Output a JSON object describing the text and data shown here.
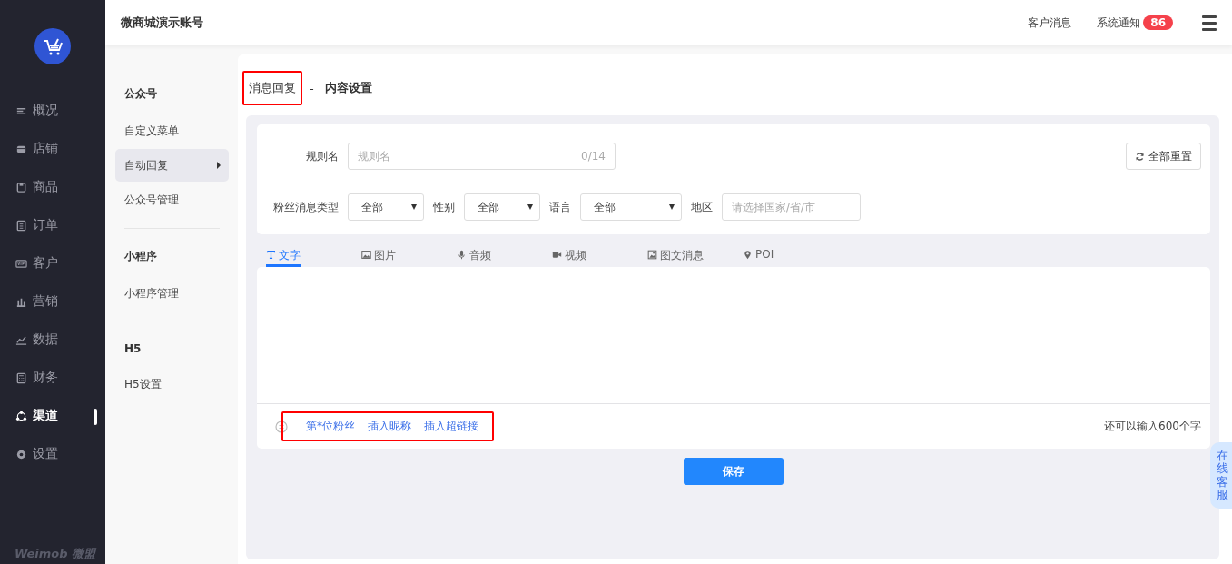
{
  "sidebar": {
    "logo": "Weimob 微盟",
    "items": [
      {
        "label": "概况",
        "kind": "lines",
        "selected": false
      },
      {
        "label": "店铺",
        "kind": "store",
        "selected": false
      },
      {
        "label": "商品",
        "kind": "bag",
        "selected": false
      },
      {
        "label": "订单",
        "kind": "list",
        "selected": false
      },
      {
        "label": "客户",
        "kind": "vip",
        "selected": false
      },
      {
        "label": "营销",
        "kind": "bars",
        "selected": false
      },
      {
        "label": "数据",
        "kind": "chart",
        "selected": false
      },
      {
        "label": "财务",
        "kind": "calc",
        "selected": false
      },
      {
        "label": "渠道",
        "kind": "nodes",
        "selected": true
      },
      {
        "label": "设置",
        "kind": "gear",
        "selected": false
      }
    ]
  },
  "header": {
    "account": "微商城演示账号",
    "links": [
      {
        "label": "客户消息"
      },
      {
        "label": "系统通知",
        "badge": "86"
      }
    ]
  },
  "subnav": {
    "groups": [
      {
        "title": "公众号",
        "items": [
          {
            "label": "自定义菜单",
            "selected": false
          },
          {
            "label": "自动回复",
            "selected": true
          },
          {
            "label": "公众号管理",
            "selected": false
          }
        ]
      },
      {
        "title": "小程序",
        "items": [
          {
            "label": "小程序管理",
            "selected": false
          }
        ]
      },
      {
        "title": "H5",
        "items": [
          {
            "label": "H5设置",
            "selected": false
          }
        ]
      }
    ]
  },
  "page": {
    "breadcrumb": "消息回复",
    "breadcrumb_highlighted": true,
    "separator": "-",
    "title": "内容设置"
  },
  "filters": {
    "rule_name": {
      "label": "规则名",
      "placeholder": "规则名",
      "counter": "0/14"
    },
    "reset_button": "全部重置",
    "selects": [
      {
        "label": "粉丝消息类型",
        "value": "全部"
      },
      {
        "label": "性别",
        "value": "全部"
      },
      {
        "label": "语言",
        "value": "全部"
      }
    ],
    "region": {
      "label": "地区",
      "placeholder": "请选择国家/省/市"
    }
  },
  "tabs": [
    {
      "label": "文字",
      "kind": "text",
      "selected": true
    },
    {
      "label": "图片",
      "kind": "image",
      "selected": false
    },
    {
      "label": "音频",
      "kind": "mic",
      "selected": false
    },
    {
      "label": "视频",
      "kind": "video",
      "selected": false
    },
    {
      "label": "图文消息",
      "kind": "article",
      "selected": false
    },
    {
      "label": "POI",
      "kind": "pin",
      "selected": false
    }
  ],
  "editor": {
    "insert_links": [
      "第*位粉丝",
      "插入昵称",
      "插入超链接"
    ],
    "links_highlighted": true,
    "remaining": "还可以输入600个字"
  },
  "save_button": "保存",
  "service_float": "在线客服"
}
